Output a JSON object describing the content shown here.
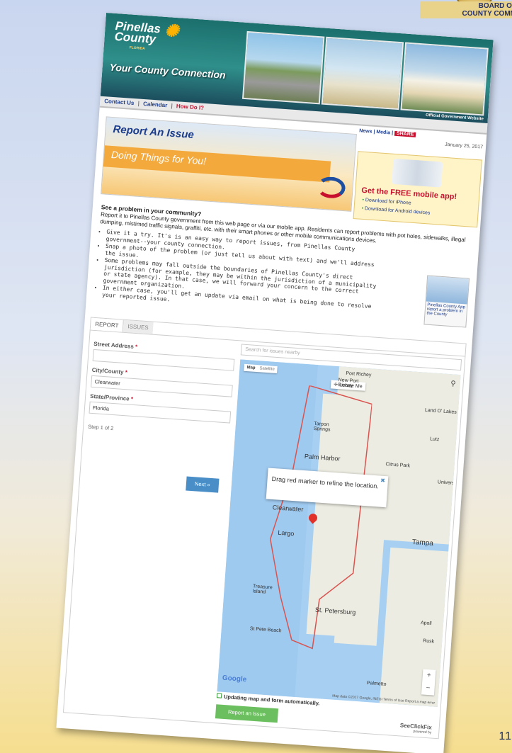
{
  "slide": {
    "number": "11"
  },
  "seal": {
    "line1": "BOARD OF",
    "line2": "COUNTY COMM"
  },
  "site": {
    "logo_line1": "Pinellas",
    "logo_line2": "County",
    "logo_sub": "FLORIDA",
    "tagline": "Your County Connection",
    "official": "Official Government Website"
  },
  "nav": {
    "contact": "Contact Us",
    "calendar": "Calendar",
    "howdo": "How Do I?"
  },
  "toolbar": {
    "news": "News",
    "media": "Media",
    "share": "SHARE",
    "date": "January 25, 2017"
  },
  "hero": {
    "title": "Report An Issue",
    "subtitle": "Doing Things for You!"
  },
  "app": {
    "headline": "Get the FREE mobile app!",
    "iphone": "Download for iPhone",
    "android": "Download for Android devices",
    "badge": "Pinellas County App report a problem in the County"
  },
  "intro": {
    "heading": "See a problem in your community?",
    "body": "Report it to Pinellas County government from this web page or via our mobile app. Residents can report problems with pot holes, sidewalks, illegal dumping, mistimed traffic signals, graffiti, etc. with their smart phones or other mobile communications devices."
  },
  "bullets": [
    "Give it a try. It's is an easy way to report issues, from Pinellas County government--your county connection.",
    "Snap a photo of the problem (or just tell us about with text) and we'll address the issue.",
    "Some problems may fall outside the boundaries of Pinellas County's direct jurisdiction (for example, they may be within the jurisdiction of a municipality or state agency). In that case, we will forward your concern to the correct government organization.",
    "In either case, you'll get an update via email on what is being done to resolve your reported issue."
  ],
  "widget": {
    "tab_report": "REPORT",
    "tab_issues": "ISSUES",
    "street_label": "Street Address",
    "city_label": "City/County",
    "city_value": "Clearwater",
    "state_label": "State/Province",
    "state_value": "Florida",
    "step": "Step 1 of 2",
    "next": "Next »",
    "search_placeholder": "Search for issues nearby",
    "map_type": "Map",
    "satellite": "Satellite",
    "locate": "Locate Me",
    "popup": "Drag red marker to refine the location.",
    "google": "Google",
    "map_footer": "Map data ©2017 Google, INEGI   Terms of Use   Report a map error",
    "checkbox": "Updating map and form automatically.",
    "report_btn": "Report an Issue",
    "powered_by_brand": "SeeClickFix",
    "powered_by": "powered by"
  },
  "map_labels": {
    "port_richey": "Port Richey",
    "new_port_richey": "New Port Richey",
    "tarpon": "Tarpon Springs",
    "land_o_lakes": "Land O' Lakes",
    "lutz": "Lutz",
    "palm_harbor": "Palm Harbor",
    "citrus_park": "Citrus Park",
    "clearwater": "Clearwater",
    "largo": "Largo",
    "tampa": "Tampa",
    "treasure_island": "Treasure Island",
    "st_pete": "St. Petersburg",
    "st_pete_beach": "St Pete Beach",
    "palmetto": "Palmetto",
    "univers": "Univers",
    "apoll": "Apoll",
    "rusk": "Rusk"
  }
}
